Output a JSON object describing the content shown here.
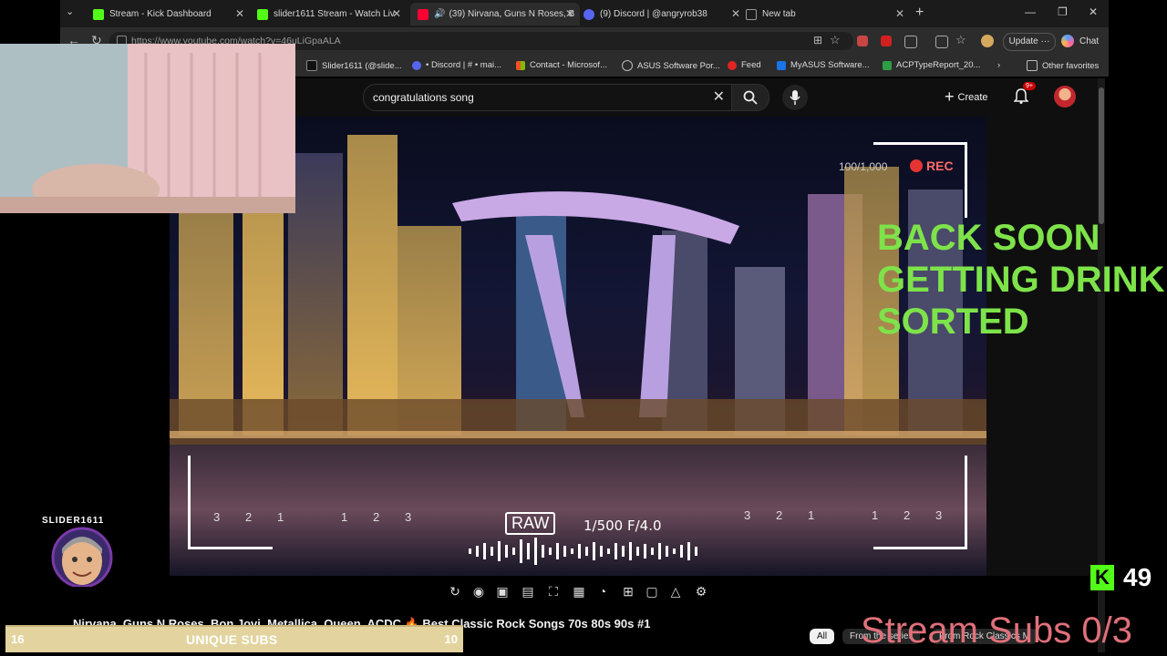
{
  "tabs": [
    {
      "label": "Stream - Kick Dashboard",
      "color": "#53fc18"
    },
    {
      "label": "slider1611 Stream - Watch Liv",
      "color": "#53fc18"
    },
    {
      "label": "(39) Nirvana, Guns N Roses, B",
      "color": "#ff0033"
    },
    {
      "label": "(9) Discord | @angryrob38",
      "color": "#5865f2"
    },
    {
      "label": "New tab",
      "color": "#999999"
    }
  ],
  "address": {
    "url": "https://www.youtube.com/watch?v=46uLiGpaALA",
    "update_label": "Update",
    "chat_label": "Chat"
  },
  "bookmarks": [
    {
      "label": "Slider1611 (@slide...",
      "color": "#222"
    },
    {
      "label": "• Discord | # • mai...",
      "color": "#5865f2"
    },
    {
      "label": "Contact - Microsof...",
      "color": "#f25022"
    },
    {
      "label": "ASUS Software Por...",
      "color": "#888888"
    },
    {
      "label": "Feed",
      "color": "#e02424"
    },
    {
      "label": "MyASUS Software...",
      "color": "#1a73e8"
    },
    {
      "label": "ACPTypeReport_20...",
      "color": "#2e9e44"
    },
    {
      "label": "Other favorites",
      "color": "#888888"
    }
  ],
  "youtube": {
    "search_query": "congratulations song",
    "create_label": "Create",
    "notif_badge": "9+"
  },
  "video": {
    "rec_counter": "100/1,000",
    "rec_label": "REC",
    "raw_label": "RAW",
    "exposure": "1/500   F/4.0",
    "scale_left": [
      "3",
      "2",
      "1",
      "1",
      "2",
      "3"
    ],
    "scale_right": [
      "3",
      "2",
      "1",
      "1",
      "2",
      "3"
    ]
  },
  "title": "Nirvana, Guns N Roses, Bon Jovi, Metallica, Queen, ACDC 🔥 Best Classic Rock Songs 70s 80s 90s #1",
  "chips": {
    "all": "All",
    "c1": "From the series",
    "c2": "From Rock Classics M"
  },
  "overlay": {
    "back_soon_lines": [
      "BACK SOON",
      "GETTING DRINK",
      "SORTED"
    ],
    "badge_name": "SLIDER1611",
    "kick_count": "49",
    "stream_subs": "Stream Subs 0/3",
    "unique_left": "16",
    "unique_label": "UNIQUE SUBS",
    "unique_right": "10"
  }
}
